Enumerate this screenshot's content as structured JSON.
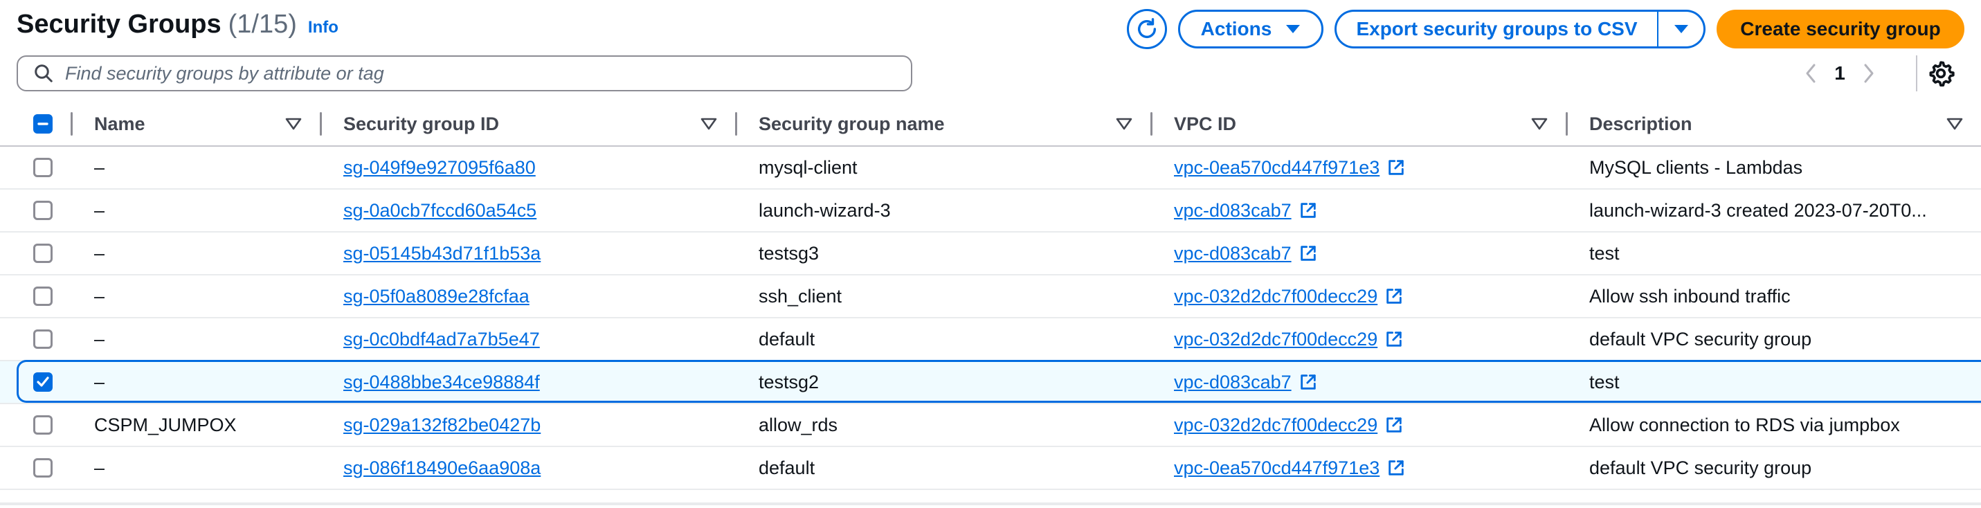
{
  "header": {
    "title": "Security Groups",
    "count": "(1/15)",
    "info": "Info",
    "actions_label": "Actions",
    "export_label": "Export security groups to CSV",
    "create_label": "Create security group"
  },
  "search": {
    "placeholder": "Find security groups by attribute or tag",
    "value": ""
  },
  "pagination": {
    "current_page": "1"
  },
  "columns": {
    "name": "Name",
    "sg_id": "Security group ID",
    "sg_name": "Security group name",
    "vpc_id": "VPC ID",
    "description": "Description"
  },
  "rows": [
    {
      "name": "–",
      "sg_id": "sg-049f9e927095f6a80",
      "sg_name": "mysql-client",
      "vpc_id": "vpc-0ea570cd447f971e3",
      "description": "MySQL clients - Lambdas",
      "selected": false
    },
    {
      "name": "–",
      "sg_id": "sg-0a0cb7fccd60a54c5",
      "sg_name": "launch-wizard-3",
      "vpc_id": "vpc-d083cab7",
      "description": "launch-wizard-3 created 2023-07-20T0...",
      "selected": false
    },
    {
      "name": "–",
      "sg_id": "sg-05145b43d71f1b53a",
      "sg_name": "testsg3",
      "vpc_id": "vpc-d083cab7",
      "description": "test",
      "selected": false
    },
    {
      "name": "–",
      "sg_id": "sg-05f0a8089e28fcfaa",
      "sg_name": "ssh_client",
      "vpc_id": "vpc-032d2dc7f00decc29",
      "description": "Allow ssh inbound traffic",
      "selected": false
    },
    {
      "name": "–",
      "sg_id": "sg-0c0bdf4ad7a7b5e47",
      "sg_name": "default",
      "vpc_id": "vpc-032d2dc7f00decc29",
      "description": "default VPC security group",
      "selected": false
    },
    {
      "name": "–",
      "sg_id": "sg-0488bbe34ce98884f",
      "sg_name": "testsg2",
      "vpc_id": "vpc-d083cab7",
      "description": "test",
      "selected": true
    },
    {
      "name": "CSPM_JUMPOX",
      "sg_id": "sg-029a132f82be0427b",
      "sg_name": "allow_rds",
      "vpc_id": "vpc-032d2dc7f00decc29",
      "description": "Allow connection to RDS via jumpbox",
      "selected": false
    },
    {
      "name": "–",
      "sg_id": "sg-086f18490e6aa908a",
      "sg_name": "default",
      "vpc_id": "vpc-0ea570cd447f971e3",
      "description": "default VPC security group",
      "selected": false
    }
  ],
  "colors": {
    "accent": "#006ce0",
    "primary_button": "#ff9900",
    "text": "#0f141a",
    "muted": "#5f6b7a"
  },
  "icons": {
    "refresh": "refresh-icon",
    "caret": "caret-down-icon",
    "search": "search-icon",
    "external": "external-link-icon",
    "settings": "gear-icon",
    "sort": "sort-icon"
  }
}
